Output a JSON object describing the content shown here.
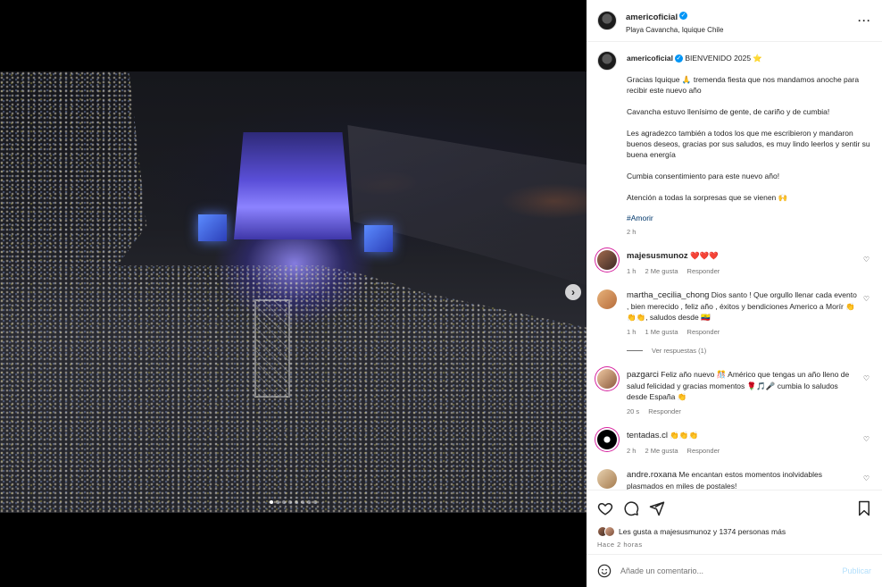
{
  "post": {
    "username": "americoficial",
    "location": "Playa Cavancha, Iquique Chile"
  },
  "caption": {
    "username": "americoficial",
    "title": "BIENVENIDO 2025 ⭐",
    "body": "Gracias Iquique 🙏 tremenda fiesta que nos mandamos anoche para recibir este nuevo año\n\nCavancha estuvo llenísimo de gente, de cariño y de cumbia!\n\nLes agradezco también a todos los que me escribieron y mandaron buenos deseos, gracias por sus saludos, es muy lindo leerlos y sentir su buena energía\n\nCumbia consentimiento para este nuevo año!\n\nAtención a todas la sorpresas que se vienen 🙌",
    "hashtag": "#Amorir",
    "time": "2 h"
  },
  "comments": [
    {
      "username": "majesusmunoz",
      "text": "❤️❤️❤️",
      "time": "1 h",
      "likes": "2 Me gusta",
      "reply": "Responder"
    },
    {
      "username": "martha_cecilia_chong",
      "text": "Dios santo ! Que orgullo llenar cada evento , bien merecido , feliz año , éxitos y bendiciones Americo a Morír 👏👏👏, saludos desde 🇪🇨",
      "time": "1 h",
      "likes": "1 Me gusta",
      "reply": "Responder",
      "view_replies": "Ver respuestas (1)"
    },
    {
      "username": "pazgarci",
      "text": "Feliz año nuevo 🎊 Américo que tengas un año lleno de salud felicidad y gracias momentos 🌹🎵🎤 cumbia lo saludos desde España 👏",
      "time": "20 s",
      "reply": "Responder"
    },
    {
      "username": "tentadas.cl",
      "text": "👏👏👏",
      "time": "2 h",
      "likes": "2 Me gusta",
      "reply": "Responder"
    },
    {
      "username": "andre.roxana",
      "text": "Me encantan estos momentos inolvidables plasmados en miles de postales!"
    }
  ],
  "likes_summary": "Les gusta a majesusmunoz y 1374 personas más",
  "time_ago": "HACE 2 HORAS",
  "time_ago_display": "Hace 2 horas",
  "comment_box": {
    "placeholder": "Añade un comentario...",
    "publish_label": "Publicar"
  },
  "carousel": {
    "count": 8,
    "active_index": 0
  },
  "colors": {
    "verified": "#0095f6",
    "hashtag": "#00376b",
    "publish_disabled": "#b2dffc",
    "story_ring": "#d6249f"
  },
  "icons": [
    "more-options-icon",
    "verified-badge-icon",
    "heart-icon",
    "comment-icon",
    "share-icon",
    "bookmark-icon",
    "emoji-icon",
    "next-arrow-icon"
  ]
}
